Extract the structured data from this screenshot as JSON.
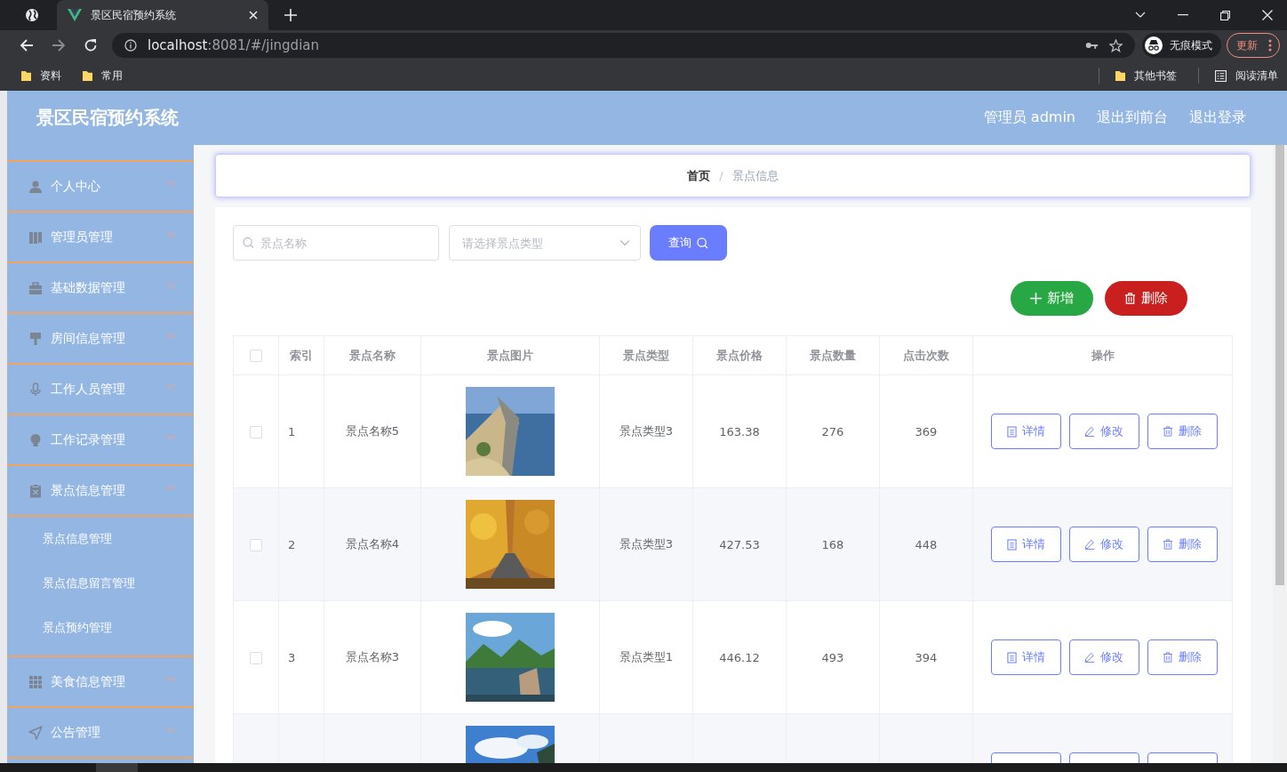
{
  "browser": {
    "tab_title": "景区民宿预约系统",
    "url_host": "localhost",
    "url_rest": ":8081/#/jingdian",
    "profile_label": "无痕模式",
    "update_label": "更新",
    "bookmarks": [
      "资料",
      "常用"
    ],
    "other_bookmarks": "其他书签",
    "reading_list": "阅读清单"
  },
  "header": {
    "title": "景区民宿预约系统",
    "links": [
      "管理员 admin",
      "退出到前台",
      "退出登录"
    ]
  },
  "sidebar": {
    "items": [
      {
        "label": "个人中心",
        "expanded": false
      },
      {
        "label": "管理员管理",
        "expanded": false
      },
      {
        "label": "基础数据管理",
        "expanded": false
      },
      {
        "label": "房间信息管理",
        "expanded": false
      },
      {
        "label": "工作人员管理",
        "expanded": false
      },
      {
        "label": "工作记录管理",
        "expanded": false
      },
      {
        "label": "景点信息管理",
        "expanded": true,
        "children": [
          {
            "label": "景点信息管理"
          },
          {
            "label": "景点信息留言管理"
          },
          {
            "label": "景点预约管理"
          }
        ]
      },
      {
        "label": "美食信息管理",
        "expanded": false
      },
      {
        "label": "公告管理",
        "expanded": false
      }
    ]
  },
  "breadcrumb": [
    "首页",
    "景点信息"
  ],
  "breadcrumb_separator": "/",
  "filters": {
    "name_placeholder": "景点名称",
    "type_placeholder": "请选择景点类型",
    "query_label": "查询"
  },
  "toolbar": {
    "add_label": "新增",
    "delete_label": "删除"
  },
  "table": {
    "header_checked": false,
    "columns": [
      "索引",
      "景点名称",
      "景点图片",
      "景点类型",
      "景点价格",
      "景点数量",
      "点击次数",
      "操作"
    ],
    "rows": [
      {
        "kind": "full",
        "checked": false,
        "index": "1",
        "name": "景点名称5",
        "picture": {
          "kind": "picture"
        },
        "type": "景点类型3",
        "price": "163.38",
        "quantity": "276",
        "clicks": "369",
        "actions": [
          "详情",
          "修改",
          "删除"
        ]
      },
      {
        "kind": "full",
        "checked": false,
        "index": "2",
        "name": "景点名称4",
        "picture": {
          "kind": "picture"
        },
        "type": "景点类型3",
        "price": "427.53",
        "quantity": "168",
        "clicks": "448",
        "actions": [
          "详情",
          "修改",
          "删除"
        ]
      },
      {
        "kind": "full",
        "checked": false,
        "index": "3",
        "name": "景点名称3",
        "picture": {
          "kind": "picture"
        },
        "type": "景点类型1",
        "price": "446.12",
        "quantity": "493",
        "clicks": "394",
        "actions": [
          "详情",
          "修改",
          "删除"
        ]
      },
      {
        "kind": "cut",
        "picture": {
          "kind": "picture"
        }
      }
    ]
  }
}
